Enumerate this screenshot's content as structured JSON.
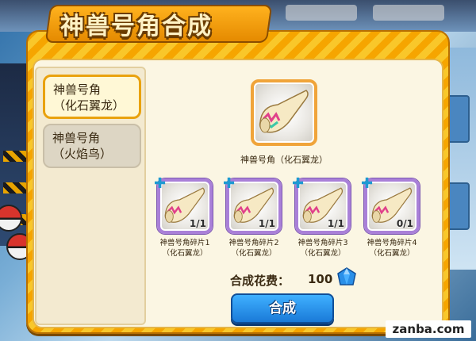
{
  "title": "神兽号角合成",
  "list": {
    "items": [
      {
        "line1": "神兽号角",
        "line2": "（化石翼龙）"
      },
      {
        "line1": "神兽号角",
        "line2": "（火焰鸟）"
      }
    ]
  },
  "target": {
    "name": "神兽号角（化石翼龙）",
    "icon": "horn-icon"
  },
  "fragments": [
    {
      "name": "神兽号角碎片1",
      "sub": "（化石翼龙）",
      "count": "1/1"
    },
    {
      "name": "神兽号角碎片2",
      "sub": "（化石翼龙）",
      "count": "1/1"
    },
    {
      "name": "神兽号角碎片3",
      "sub": "（化石翼龙）",
      "count": "1/1"
    },
    {
      "name": "神兽号角碎片4",
      "sub": "（化石翼龙）",
      "count": "0/1"
    }
  ],
  "cost": {
    "label": "合成花费：",
    "value": "100",
    "icon": "diamond-icon"
  },
  "craft_button": "合成",
  "watermark": "zanba.com",
  "colors": {
    "panel": "#f6a500",
    "accent": "#1a7ad8",
    "fragment_border": "#a980d8"
  }
}
